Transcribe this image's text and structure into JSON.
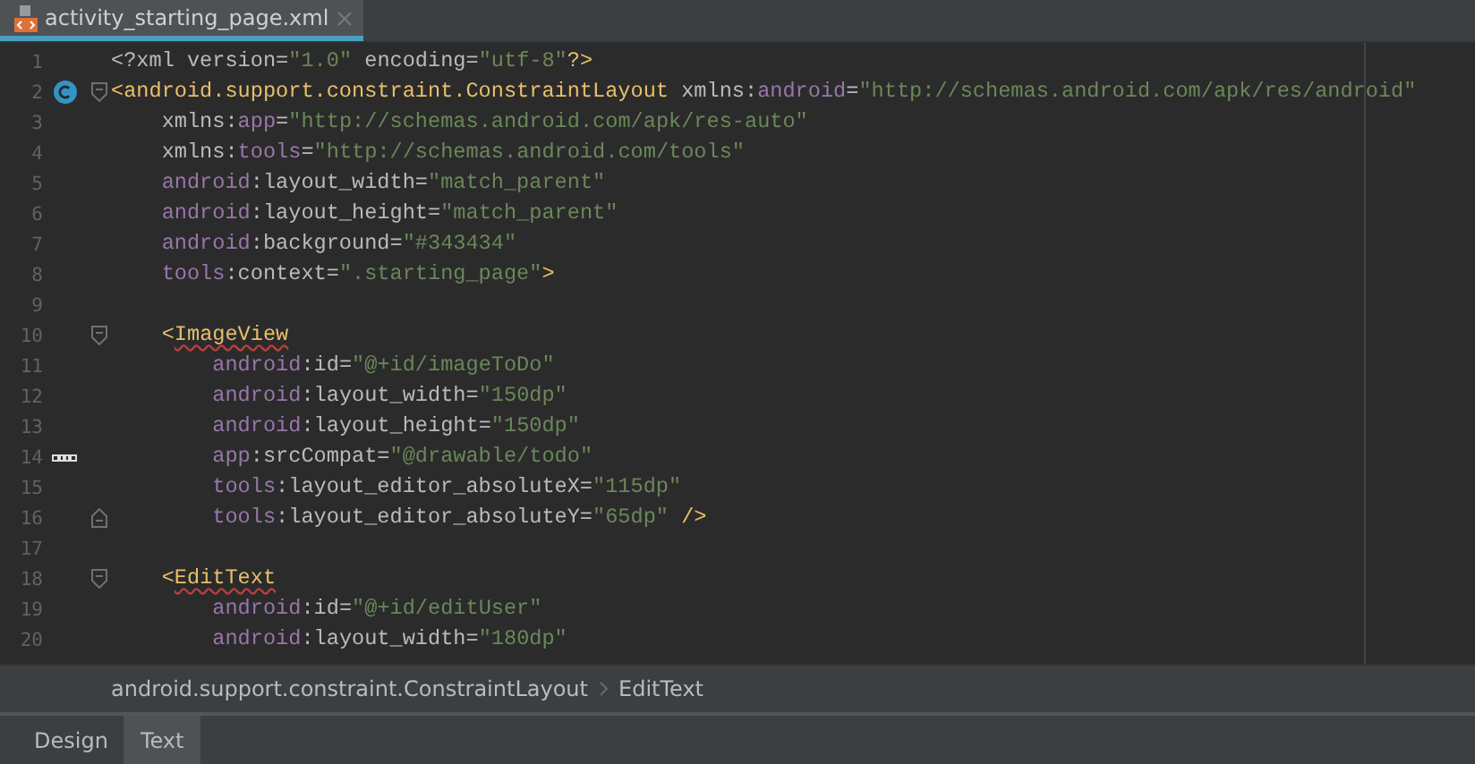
{
  "file_tabs": [
    {
      "label": "activity_starting_page.xml",
      "selected": true
    }
  ],
  "editor": {
    "lines": [
      {
        "number": "1",
        "tokens": [
          {
            "t": "<?xml version=",
            "kind": "plain"
          },
          {
            "t": "\"1.0\"",
            "kind": "value"
          },
          {
            "t": " encoding=",
            "kind": "plain"
          },
          {
            "t": "\"utf-8\"",
            "kind": "value"
          },
          {
            "t": "?>",
            "kind": "tag"
          }
        ]
      },
      {
        "number": "2",
        "gutter": {
          "kind": "class"
        },
        "fold": {
          "kind": "start"
        },
        "tokens": [
          {
            "t": "<android.support.constraint.ConstraintLayout",
            "kind": "tag"
          },
          {
            "t": " xmlns:",
            "kind": "plain"
          },
          {
            "t": "android",
            "kind": "ns"
          },
          {
            "t": "=",
            "kind": "plain"
          },
          {
            "t": "\"http://schemas.android.com/apk/res/android\"",
            "kind": "value"
          }
        ]
      },
      {
        "number": "3",
        "tokens": [
          {
            "t": "    xmlns:",
            "kind": "plain"
          },
          {
            "t": "app",
            "kind": "ns"
          },
          {
            "t": "=",
            "kind": "plain"
          },
          {
            "t": "\"http://schemas.android.com/apk/res-auto\"",
            "kind": "value"
          }
        ]
      },
      {
        "number": "4",
        "tokens": [
          {
            "t": "    xmlns:",
            "kind": "plain"
          },
          {
            "t": "tools",
            "kind": "ns"
          },
          {
            "t": "=",
            "kind": "plain"
          },
          {
            "t": "\"http://schemas.android.com/tools\"",
            "kind": "value"
          }
        ]
      },
      {
        "number": "5",
        "tokens": [
          {
            "t": "    android",
            "kind": "ns"
          },
          {
            "t": ":layout_width=",
            "kind": "plain"
          },
          {
            "t": "\"match_parent\"",
            "kind": "value"
          }
        ]
      },
      {
        "number": "6",
        "tokens": [
          {
            "t": "    android",
            "kind": "ns"
          },
          {
            "t": ":layout_height=",
            "kind": "plain"
          },
          {
            "t": "\"match_parent\"",
            "kind": "value"
          }
        ]
      },
      {
        "number": "7",
        "tokens": [
          {
            "t": "    android",
            "kind": "ns"
          },
          {
            "t": ":background=",
            "kind": "plain"
          },
          {
            "t": "\"#343434\"",
            "kind": "value"
          }
        ]
      },
      {
        "number": "8",
        "tokens": [
          {
            "t": "    tools",
            "kind": "ns"
          },
          {
            "t": ":context=",
            "kind": "plain"
          },
          {
            "t": "\".starting_page\"",
            "kind": "value"
          },
          {
            "t": ">",
            "kind": "tag"
          }
        ]
      },
      {
        "number": "9"
      },
      {
        "number": "10",
        "fold": {
          "kind": "start"
        },
        "tokens": [
          {
            "t": "    <",
            "kind": "tag"
          },
          {
            "t": "ImageView",
            "kind": "tag_flagged"
          }
        ]
      },
      {
        "number": "11",
        "tokens": [
          {
            "t": "        android",
            "kind": "ns"
          },
          {
            "t": ":id=",
            "kind": "plain"
          },
          {
            "t": "\"@+id/imageToDo\"",
            "kind": "value"
          }
        ]
      },
      {
        "number": "12",
        "tokens": [
          {
            "t": "        android",
            "kind": "ns"
          },
          {
            "t": ":layout_width=",
            "kind": "plain"
          },
          {
            "t": "\"150dp\"",
            "kind": "value"
          }
        ]
      },
      {
        "number": "13",
        "tokens": [
          {
            "t": "        android",
            "kind": "ns"
          },
          {
            "t": ":layout_height=",
            "kind": "plain"
          },
          {
            "t": "\"150dp\"",
            "kind": "value"
          }
        ]
      },
      {
        "number": "14",
        "gutter": {
          "kind": "image"
        },
        "tokens": [
          {
            "t": "        app",
            "kind": "ns"
          },
          {
            "t": ":srcCompat=",
            "kind": "plain"
          },
          {
            "t": "\"@drawable/todo\"",
            "kind": "value"
          }
        ]
      },
      {
        "number": "15",
        "tokens": [
          {
            "t": "        tools",
            "kind": "ns"
          },
          {
            "t": ":layout_editor_absoluteX=",
            "kind": "plain"
          },
          {
            "t": "\"115dp\"",
            "kind": "value"
          }
        ]
      },
      {
        "number": "16",
        "fold": {
          "kind": "end"
        },
        "tokens": [
          {
            "t": "        tools",
            "kind": "ns"
          },
          {
            "t": ":layout_editor_absoluteY=",
            "kind": "plain"
          },
          {
            "t": "\"65dp\"",
            "kind": "value"
          },
          {
            "t": " />",
            "kind": "tag"
          }
        ]
      },
      {
        "number": "17"
      },
      {
        "number": "18",
        "fold": {
          "kind": "start"
        },
        "tokens": [
          {
            "t": "    <",
            "kind": "tag"
          },
          {
            "t": "EditText",
            "kind": "tag_flagged"
          }
        ]
      },
      {
        "number": "19",
        "tokens": [
          {
            "t": "        android",
            "kind": "ns"
          },
          {
            "t": ":id=",
            "kind": "plain"
          },
          {
            "t": "\"@+id/editUser\"",
            "kind": "value"
          }
        ]
      },
      {
        "number": "20",
        "tokens": [
          {
            "t": "        android",
            "kind": "ns"
          },
          {
            "t": ":layout_width=",
            "kind": "plain"
          },
          {
            "t": "\"180dp\"",
            "kind": "value"
          }
        ]
      }
    ]
  },
  "breadcrumbs": [
    "android.support.constraint.ConstraintLayout",
    "EditText"
  ],
  "bottom_tabs": [
    {
      "label": "Design",
      "selected": false
    },
    {
      "label": "Text",
      "selected": true
    }
  ]
}
